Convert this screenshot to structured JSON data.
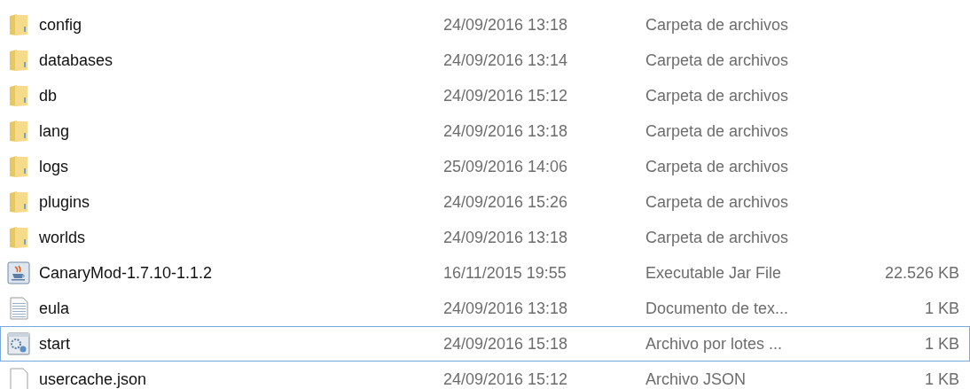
{
  "files": [
    {
      "kind": "folder",
      "name": "config",
      "modified": "24/09/2016 13:18",
      "type": "Carpeta de archivos",
      "focused": false
    },
    {
      "kind": "folder",
      "name": "databases",
      "modified": "24/09/2016 13:14",
      "type": "Carpeta de archivos",
      "focused": false
    },
    {
      "kind": "folder",
      "name": "db",
      "modified": "24/09/2016 15:12",
      "type": "Carpeta de archivos",
      "focused": false
    },
    {
      "kind": "folder",
      "name": "lang",
      "modified": "24/09/2016 13:18",
      "type": "Carpeta de archivos",
      "focused": false
    },
    {
      "kind": "folder",
      "name": "logs",
      "modified": "25/09/2016 14:06",
      "type": "Carpeta de archivos",
      "focused": false
    },
    {
      "kind": "folder",
      "name": "plugins",
      "modified": "24/09/2016 15:26",
      "type": "Carpeta de archivos",
      "focused": false
    },
    {
      "kind": "folder",
      "name": "worlds",
      "modified": "24/09/2016 13:18",
      "type": "Carpeta de archivos",
      "focused": false
    },
    {
      "kind": "jar",
      "name": "CanaryMod-1.7.10-1.1.2",
      "modified": "16/11/2015 19:55",
      "type": "Executable Jar File",
      "size": "22.526 KB",
      "focused": false
    },
    {
      "kind": "text",
      "name": "eula",
      "modified": "24/09/2016 13:18",
      "type": "Documento de tex...",
      "size": "1 KB",
      "focused": false
    },
    {
      "kind": "batch",
      "name": "start",
      "modified": "24/09/2016 15:18",
      "type": "Archivo por lotes ...",
      "size": "1 KB",
      "focused": true
    },
    {
      "kind": "file",
      "name": "usercache.json",
      "modified": "24/09/2016 15:12",
      "type": "Archivo JSON",
      "size": "1 KB",
      "focused": false
    }
  ]
}
